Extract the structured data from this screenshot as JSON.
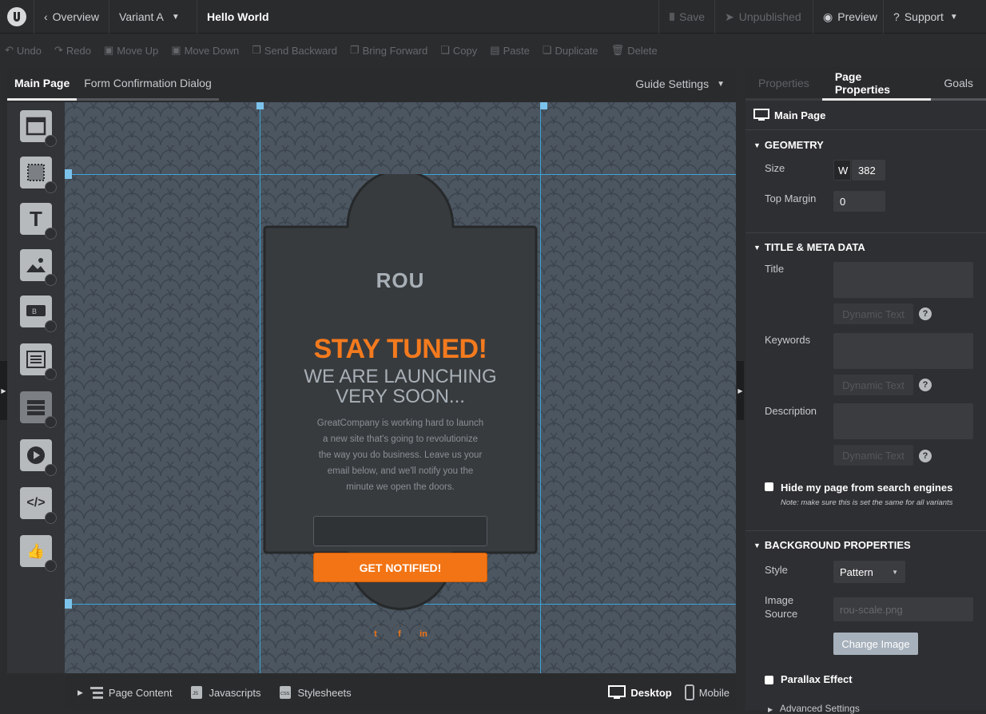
{
  "topbar": {
    "overview": "Overview",
    "variant": "Variant A",
    "title": "Hello World",
    "save": "Save",
    "unpublished": "Unpublished",
    "preview": "Preview",
    "support": "Support"
  },
  "toolbar": {
    "undo": "Undo",
    "redo": "Redo",
    "move_up": "Move Up",
    "move_down": "Move Down",
    "send_backward": "Send Backward",
    "bring_forward": "Bring Forward",
    "copy": "Copy",
    "paste": "Paste",
    "duplicate": "Duplicate",
    "delete": "Delete"
  },
  "editor": {
    "tabs": [
      "Main Page",
      "Form Confirmation Dialog"
    ],
    "guide_settings": "Guide Settings",
    "widgets": [
      "section-icon",
      "box-icon",
      "text-icon",
      "image-icon",
      "button-icon",
      "form-icon",
      "table-icon",
      "video-icon",
      "code-icon",
      "social-icon"
    ]
  },
  "page": {
    "logo_text": "ROU",
    "headline": "STAY TUNED!",
    "subheadline_1": "WE ARE LAUNCHING",
    "subheadline_2": "VERY SOON...",
    "body_lines": [
      "GreatCompany is working hard to launch",
      "a new site that's going to revolutionize",
      "the way you do business. Leave us your",
      "email below, and we'll notify you the",
      "minute we open the doors."
    ],
    "button": "GET NOTIFIED!",
    "social": [
      "twitter-icon",
      "facebook-icon",
      "linkedin-icon"
    ],
    "accent_color": "#f27414"
  },
  "bottombar": {
    "page_content": "Page Content",
    "javascripts": "Javascripts",
    "stylesheets": "Stylesheets",
    "desktop": "Desktop",
    "mobile": "Mobile"
  },
  "right_panel": {
    "tabs": [
      "Properties",
      "Page Properties",
      "Goals"
    ],
    "page_name": "Main Page",
    "geometry": {
      "heading": "GEOMETRY",
      "size_label": "Size",
      "w_label": "W",
      "width": "382",
      "top_margin_label": "Top Margin",
      "top_margin": "0"
    },
    "meta": {
      "heading": "TITLE & META DATA",
      "title_label": "Title",
      "keywords_label": "Keywords",
      "description_label": "Description",
      "dynamic_text": "Dynamic Text",
      "hide_label": "Hide my page from search engines",
      "hide_note": "Note: make sure this is set the same for all variants"
    },
    "background": {
      "heading": "BACKGROUND PROPERTIES",
      "style_label": "Style",
      "style_value": "Pattern",
      "image_source_label_1": "Image",
      "image_source_label_2": "Source",
      "image_source_placeholder": "rou-scale.png",
      "change_image": "Change Image",
      "parallax": "Parallax Effect",
      "advanced": "Advanced Settings"
    }
  }
}
